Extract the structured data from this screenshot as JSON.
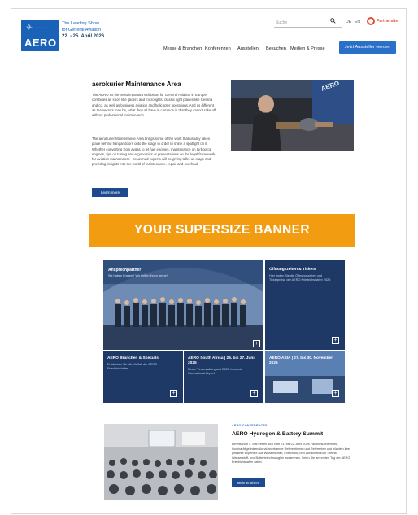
{
  "header": {
    "logo_text": "AERO",
    "tagline_1": "The Leading Show",
    "tagline_2": "for General Aviation",
    "dates": "22. - 25. April 2026",
    "search_placeholder": "Suche",
    "lang_de": "DE",
    "lang_en": "EN",
    "partner": "Partnersite",
    "nav": [
      "Messe & Branchen",
      "Konferenzen",
      "Ausstellen",
      "Besuchen",
      "Medien & Presse"
    ],
    "cta": "Jetzt Aussteller werden"
  },
  "intro": {
    "title": "aerokurier Maintenance Area",
    "p1": "The AERO as the most important exhibition for General Aviation in Europe combines air sport like gliders and microlights, classic light planes like Cessna and co. as well as business aviation and helicopter operations. And as different as the sectors may be, what they all have in common is that they cannot take off without professional maintenance.",
    "p2": "The aerokurier Maintenance Area brings some of the work that usually takes place behind hangar doors onto the stage in order to shine a spotlight on it. Whether converting from avgas to jet fuel engines, maintenance on turboprop engines, tips on tuning and ergonomics or presentations on the legal framework for aviation maintenance - renowned experts will be giving talks on stage and providing insights into the world of maintenance, repair and overhaul.",
    "button": "Learn more"
  },
  "banner": {
    "text": "YOUR SUPERSIZE BANNER"
  },
  "tiles": {
    "big": {
      "title": "Ansprechpartner",
      "subtitle": "Sie haben Fragen? Wir helfen Ihnen gerne!"
    },
    "opening": {
      "title": "Öffnungszeiten & Tickets",
      "subtitle": "Hier finden Sie die Öffnungszeiten und Ticketpreise der AERO Friedrichshafen 2025"
    },
    "branchen": {
      "title": "AERO Branchen & Specials",
      "subtitle": "Entdecken Sie die Vielfalt der AERO Friedrichshafen"
    },
    "southafrica": {
      "title": "AERO South Africa | 25. bis 27. Juni 2025",
      "subtitle": "Neuer Veranstaltungsort 2025: Lanseria International Airport"
    },
    "asia": {
      "title": "AERO ASIA | 27. bis 30. November 2025",
      "subtitle": ""
    },
    "plus": "+"
  },
  "conference": {
    "eyebrow": "AERO CONFERENCES",
    "title": "AERO Hydrogen & Battery Summit",
    "text": "Bereits zum 4. Mal treffen sich vom 21. bis 22. April 2026 Fachbesucherinnen, hochkarätige international anerkannte Referentinnen und Referenten und bündeln ihre gesamte Expertise aus Wissenschaft, Forschung und Wirtschaft zum Thema Wasserstoff- und Batterietechnologien zusammen. Seien Sie am ersten Tag der AERO Friedrichshafen dabei.",
    "button": "Mehr erfahren"
  },
  "colors": {
    "brand_blue": "#1a62b8",
    "button_navy": "#1d4a8e",
    "banner_orange": "#f29c12",
    "tile_navy": "#1e3966"
  }
}
